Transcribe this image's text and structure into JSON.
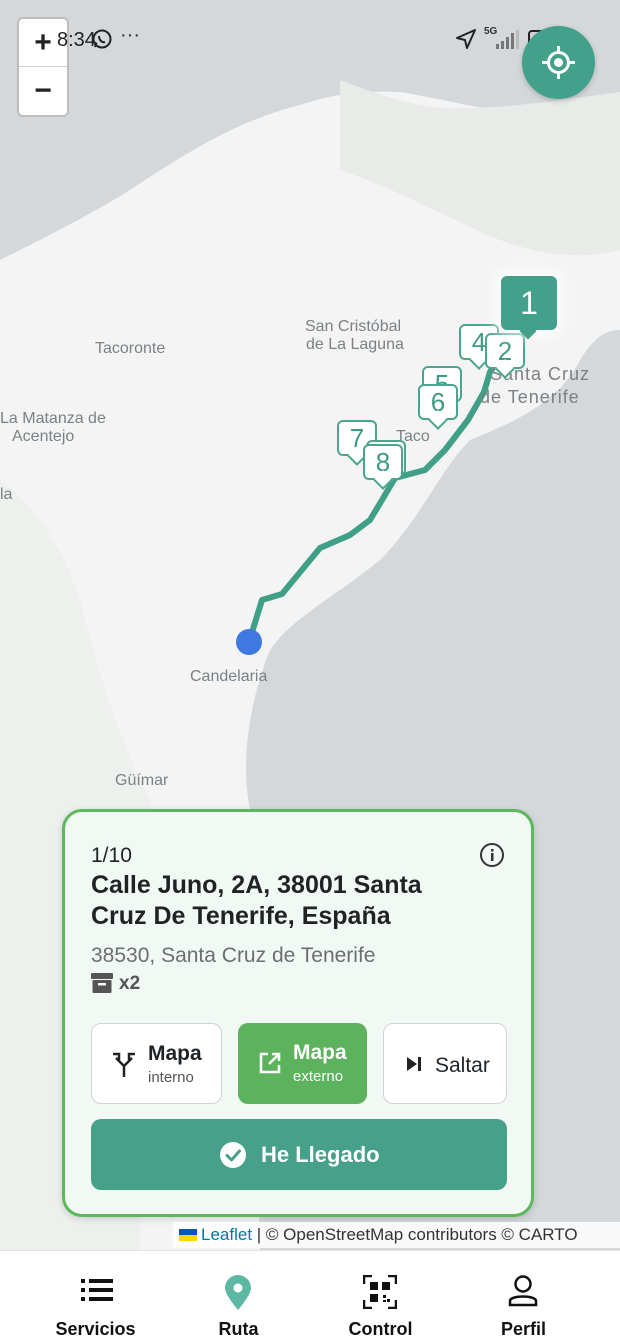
{
  "status_bar": {
    "time": "8:34",
    "more": "···",
    "network": "5G",
    "battery": "51"
  },
  "map": {
    "zoom_in": "+",
    "zoom_out": "−",
    "places": [
      "Tacoronte",
      "San Cristóbal",
      "de La Laguna",
      "Santa Cruz",
      "de Tenerife",
      "La Matanza de",
      "Acentejo",
      "la",
      "Taco",
      "Candelaria",
      "Güímar"
    ],
    "markers": [
      "1",
      "2",
      "4",
      "5",
      "6",
      "7",
      "8"
    ],
    "attribution": {
      "leaflet": "Leaflet",
      "rest": " | © OpenStreetMap contributors © CARTO"
    }
  },
  "card": {
    "counter": "1/10",
    "address": "Calle Juno, 2A, 38001 Santa Cruz De Tenerife, España",
    "subaddress": "38530, Santa Cruz de Tenerife",
    "packages": "x2",
    "buttons": {
      "internal": {
        "title": "Mapa",
        "subtitle": "interno"
      },
      "external": {
        "title": "Mapa",
        "subtitle": "externo"
      },
      "skip": {
        "title": "Saltar"
      }
    },
    "arrived": "He Llegado"
  },
  "tabs": [
    "Servicios",
    "Ruta",
    "Control",
    "Perfil"
  ],
  "colors": {
    "primary": "#47a18a",
    "accent_green": "#5db35d",
    "route": "#3f9f87",
    "current_location": "#3f78e0"
  }
}
